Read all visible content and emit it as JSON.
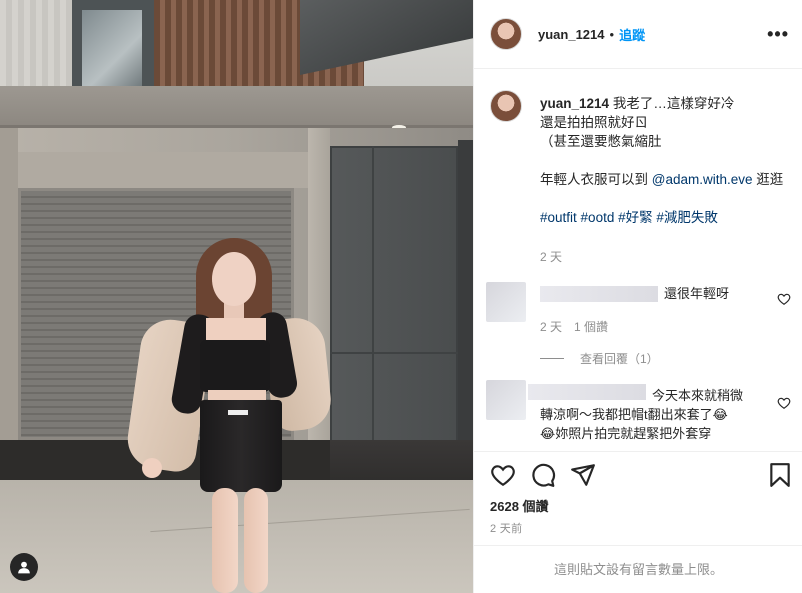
{
  "post": {
    "username": "yuan_1214",
    "separator": "•",
    "follow_label": "追蹤",
    "more_label": "•••"
  },
  "caption": {
    "username": "yuan_1214",
    "line1": "我老了…這樣穿好冷",
    "line2": "還是拍拍照就好ㄖ",
    "line3": "（甚至還要憋氣縮肚",
    "line4_prefix": "年輕人衣服可以到",
    "mention": "@adam.with.eve",
    "line4_suffix": "逛逛",
    "hashtags": [
      "#outfit",
      "#ootd",
      "#好緊",
      "#減肥失敗"
    ],
    "time": "2 天"
  },
  "comments": [
    {
      "text": "還很年輕呀",
      "time": "2 天",
      "likes": "1 個讚",
      "replies_label": "查看回覆（1）"
    },
    {
      "line1": "今天本來就稍微",
      "line2": "轉涼啊～我都把帽t翻出來套了😂",
      "line3": "😂妳照片拍完就趕緊把外套穿"
    }
  ],
  "actions": {
    "likes": "2628 個讚",
    "posted": "2 天前",
    "comments_closed": "這則貼文設有留言數量上限。"
  },
  "icons": {
    "user_tag": "user-tag-icon",
    "heart": "heart-icon",
    "comment": "comment-icon",
    "share": "share-icon",
    "save": "bookmark-icon",
    "more": "more-options-icon"
  },
  "colors": {
    "link": "#0095f6",
    "hashtag": "#00376b",
    "muted": "#8e8e8e",
    "border": "#efefef"
  }
}
